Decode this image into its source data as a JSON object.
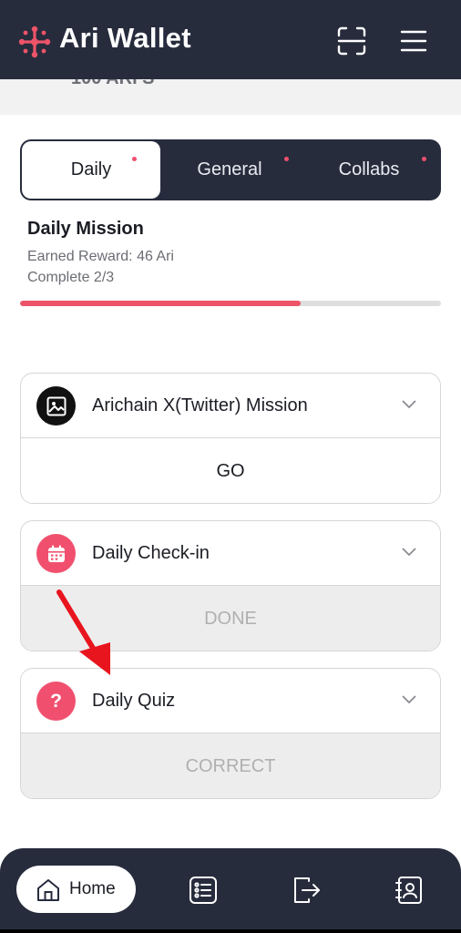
{
  "header": {
    "title": "Ari Wallet",
    "logo_icon": "ari-wallet-logo",
    "scan_icon": "scan-icon",
    "menu_icon": "hamburger-menu-icon"
  },
  "partial_strip": {
    "text": "100 ARI S"
  },
  "tabs": [
    {
      "label": "Daily",
      "active": true,
      "has_dot": true
    },
    {
      "label": "General",
      "active": false,
      "has_dot": true
    },
    {
      "label": "Collabs",
      "active": false,
      "has_dot": true
    }
  ],
  "mission": {
    "title": "Daily Mission",
    "earned": "Earned Reward: 46 Ari",
    "complete": "Complete 2/3",
    "progress_percent": 66.7
  },
  "cards": [
    {
      "title": "Arichain X(Twitter) Mission",
      "icon": "image-icon",
      "action": "GO",
      "action_enabled": true
    },
    {
      "title": "Daily Check-in",
      "icon": "calendar-icon",
      "action": "DONE",
      "action_enabled": false
    },
    {
      "title": "Daily Quiz",
      "icon": "question-icon",
      "action": "CORRECT",
      "action_enabled": false
    }
  ],
  "bottom_nav": {
    "home_label": "Home",
    "items": [
      "home-icon",
      "list-icon",
      "exit-icon",
      "contacts-icon"
    ]
  },
  "colors": {
    "header_bg": "#272c3d",
    "accent": "#ed5469",
    "disabled_bg": "#ededed"
  }
}
